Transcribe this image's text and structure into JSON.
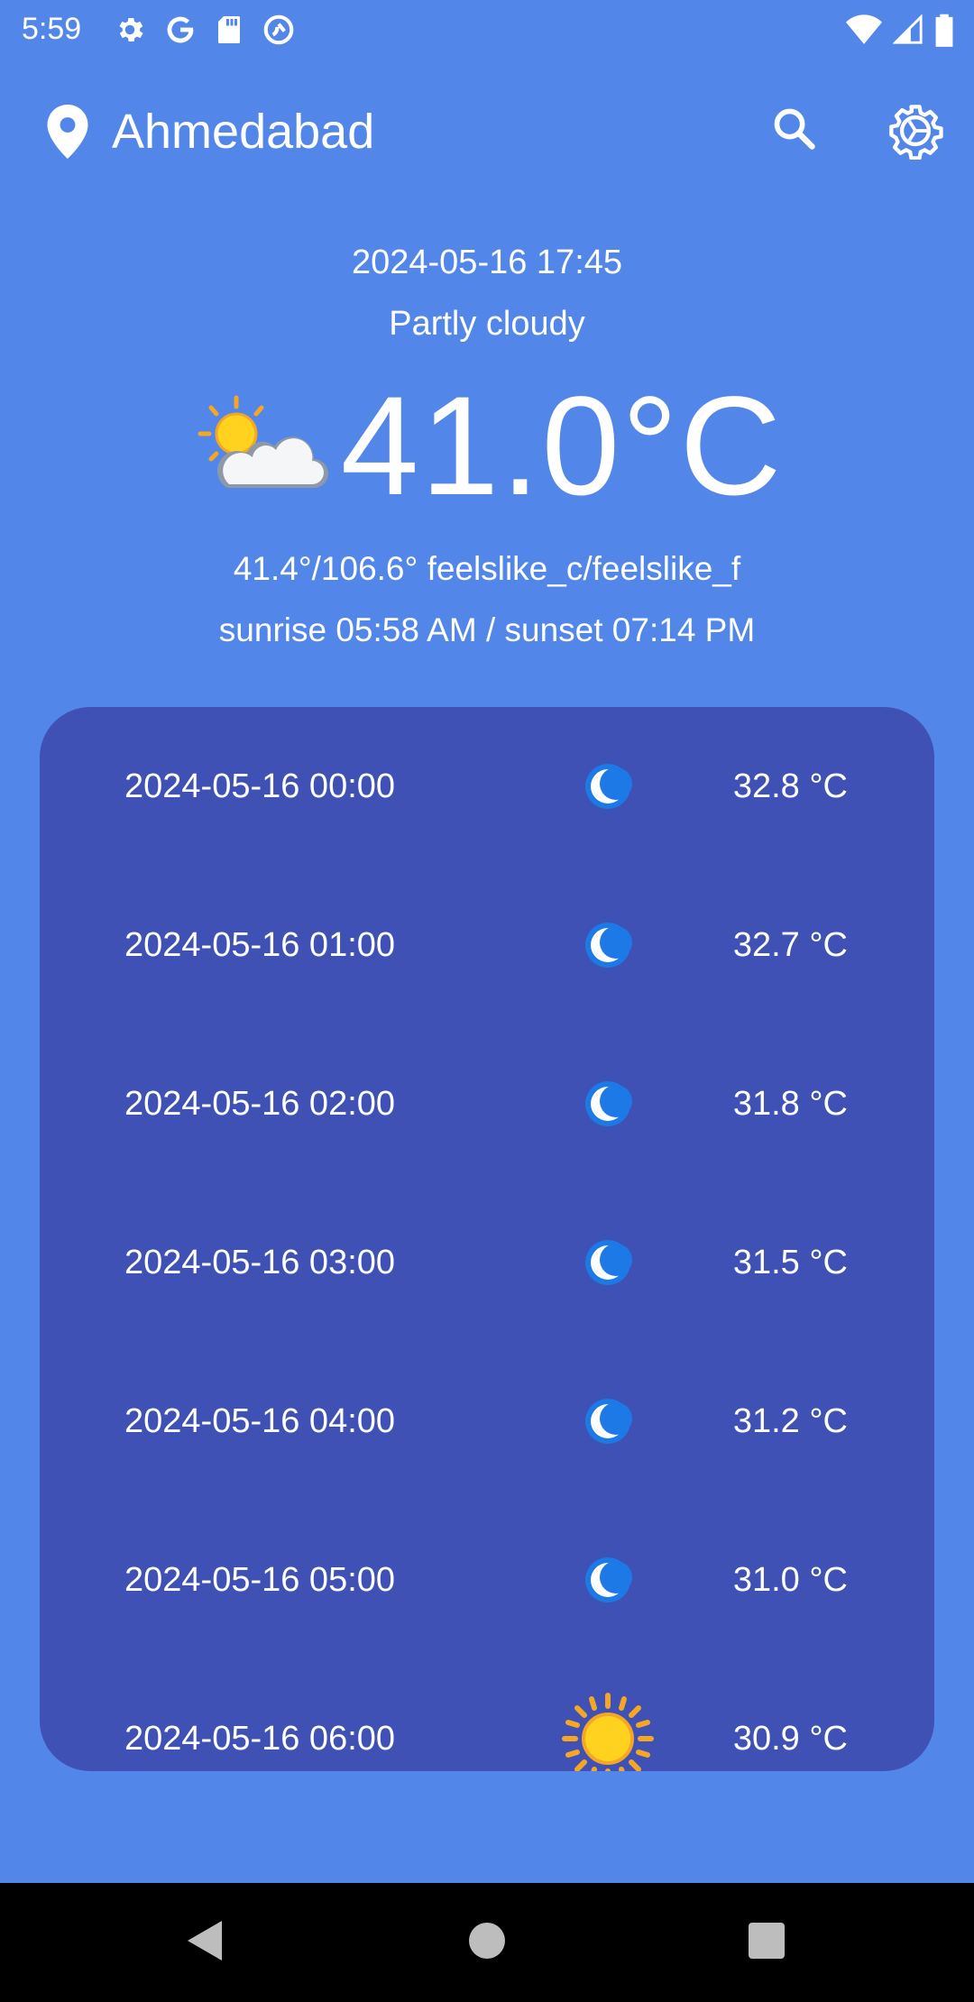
{
  "status_bar": {
    "time": "5:59",
    "icons_left": [
      "settings-icon",
      "google-icon",
      "sd-card-icon",
      "sync-icon"
    ],
    "icons_right": [
      "wifi-icon",
      "signal-icon",
      "battery-icon"
    ]
  },
  "header": {
    "city": "Ahmedabad",
    "location_icon": "location-pin-icon",
    "search_icon": "search-icon",
    "settings_icon": "settings-gear-icon"
  },
  "current": {
    "datetime": "2024-05-16 17:45",
    "condition": "Partly cloudy",
    "temperature": "41.0°C",
    "icon": "partly-cloudy-icon",
    "feels_like": "41.4°/106.6° feelslike_c/feelslike_f",
    "sun_times": "sunrise 05:58 AM / sunset 07:14 PM"
  },
  "hourly": [
    {
      "time": "2024-05-16 00:00",
      "icon": "moon-icon",
      "temp": "32.8 °C"
    },
    {
      "time": "2024-05-16 01:00",
      "icon": "moon-icon",
      "temp": "32.7 °C"
    },
    {
      "time": "2024-05-16 02:00",
      "icon": "moon-icon",
      "temp": "31.8 °C"
    },
    {
      "time": "2024-05-16 03:00",
      "icon": "moon-icon",
      "temp": "31.5 °C"
    },
    {
      "time": "2024-05-16 04:00",
      "icon": "moon-icon",
      "temp": "31.2 °C"
    },
    {
      "time": "2024-05-16 05:00",
      "icon": "moon-icon",
      "temp": "31.0 °C"
    },
    {
      "time": "2024-05-16 06:00",
      "icon": "sun-icon",
      "temp": "30.9 °C"
    }
  ],
  "nav_bar": {
    "buttons": [
      "back-icon",
      "home-icon",
      "recents-icon"
    ]
  },
  "colors": {
    "background": "#5287E9",
    "card": "#3F51B5",
    "text": "#FFFFFF",
    "nav_bar": "#000000"
  }
}
